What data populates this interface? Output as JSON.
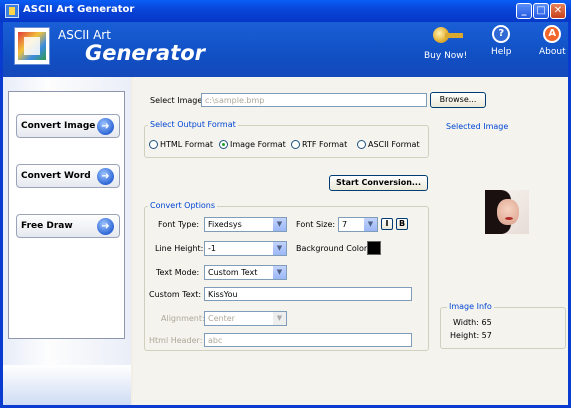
{
  "window": {
    "title": "ASCII Art Generator",
    "min": "_",
    "max": "□",
    "close": "✕"
  },
  "header": {
    "app_line1": "ASCII Art",
    "app_line2": "Generator",
    "buy_label": "Buy Now!",
    "help_label": "Help",
    "help_glyph": "?",
    "about_label": "About",
    "about_glyph": "A"
  },
  "sidebar": {
    "items": [
      {
        "label": "Convert Image"
      },
      {
        "label": "Convert Word"
      },
      {
        "label": "Free Draw"
      }
    ],
    "arrow_glyph": "➜"
  },
  "main": {
    "select_image_label": "Select Image:",
    "select_image_value": "c:\\sample.bmp",
    "browse_label": "Browse...",
    "output_format": {
      "title": "Select Output Format",
      "options": [
        "HTML Format",
        "Image Format",
        "RTF Format",
        "ASCII Format"
      ],
      "selected": "Image Format"
    },
    "start_label": "Start Conversion...",
    "convert_options": {
      "title": "Convert Options",
      "font_type_label": "Font Type:",
      "font_type_value": "Fixedsys",
      "font_size_label": "Font Size:",
      "font_size_value": "7",
      "italic_label": "I",
      "bold_label": "B",
      "line_height_label": "Line Height:",
      "line_height_value": "-1",
      "bg_color_label": "Background Color:",
      "bg_color_value": "#000000",
      "text_mode_label": "Text Mode:",
      "text_mode_value": "Custom Text",
      "custom_text_label": "Custom Text:",
      "custom_text_value": "KissYou",
      "alignment_label": "Alignment:",
      "alignment_value": "Center",
      "html_header_label": "Html Header:",
      "html_header_value": "abc"
    },
    "selected_image": {
      "title": "Selected Image"
    },
    "image_info": {
      "title": "Image Info",
      "width_text": "Width: 65",
      "height_text": "Height: 57"
    }
  },
  "colors": {
    "titlebar": "#0844d8",
    "header": "#1150c4",
    "group_title": "#0046d5"
  }
}
